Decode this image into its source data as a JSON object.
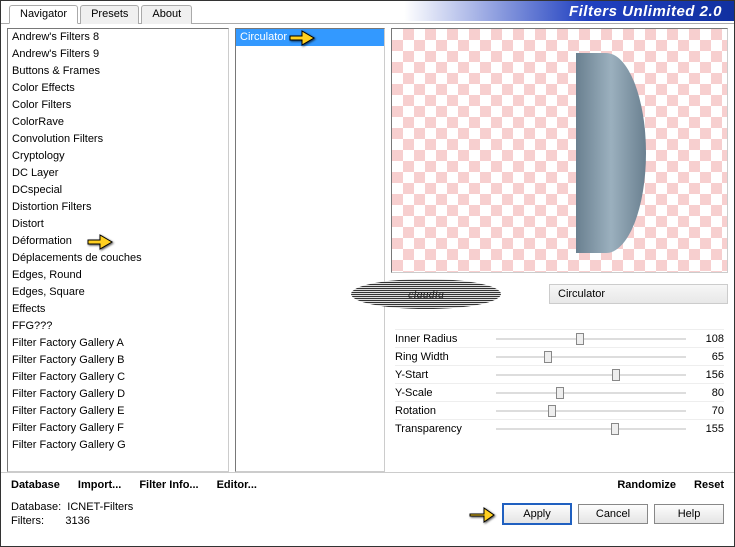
{
  "app_title": "Filters Unlimited 2.0",
  "tabs": [
    "Navigator",
    "Presets",
    "About"
  ],
  "active_tab": 0,
  "categories": [
    "Andrew's Filters 8",
    "Andrew's Filters 9",
    "Buttons & Frames",
    "Color Effects",
    "Color Filters",
    "ColorRave",
    "Convolution Filters",
    "Cryptology",
    "DC Layer",
    "DCspecial",
    "Distortion Filters",
    "Distort",
    "Déformation",
    "Déplacements de couches",
    "Edges, Round",
    "Edges, Square",
    "Effects",
    "FFG???",
    "Filter Factory Gallery A",
    "Filter Factory Gallery B",
    "Filter Factory Gallery C",
    "Filter Factory Gallery D",
    "Filter Factory Gallery E",
    "Filter Factory Gallery F",
    "Filter Factory Gallery G"
  ],
  "selected_category_index": 12,
  "filters": [
    "Circulator"
  ],
  "selected_filter_index": 0,
  "filter_title": "Circulator",
  "sliders": [
    {
      "label": "Inner Radius",
      "value": 108,
      "max": 255
    },
    {
      "label": "Ring Width",
      "value": 65,
      "max": 255
    },
    {
      "label": "Y-Start",
      "value": 156,
      "max": 255
    },
    {
      "label": "Y-Scale",
      "value": 80,
      "max": 255
    },
    {
      "label": "Rotation",
      "value": 70,
      "max": 255
    },
    {
      "label": "Transparency",
      "value": 155,
      "max": 255
    }
  ],
  "toolbar": {
    "database": "Database",
    "import": "Import...",
    "filter_info": "Filter Info...",
    "editor": "Editor...",
    "randomize": "Randomize",
    "reset": "Reset"
  },
  "status": {
    "db_label": "Database:",
    "db_value": "ICNET-Filters",
    "filters_label": "Filters:",
    "filters_value": "3136"
  },
  "buttons": {
    "apply": "Apply",
    "cancel": "Cancel",
    "help": "Help"
  },
  "watermark": "claudia"
}
